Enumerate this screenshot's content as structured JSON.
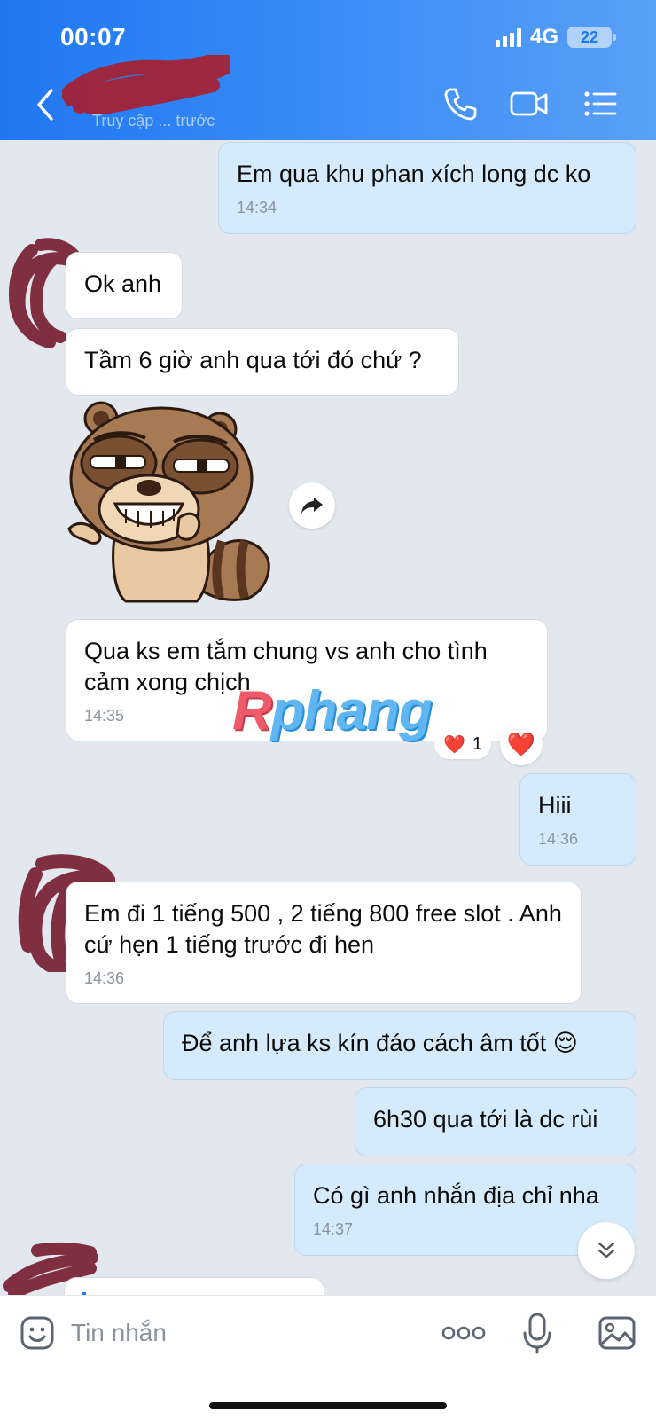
{
  "status_bar": {
    "time": "00:07",
    "network": "4G",
    "battery": "22"
  },
  "header": {
    "contact_status": "Truy cập ... trước"
  },
  "messages": [
    {
      "text": "Em qua khu phan xích long dc ko",
      "time": "14:34"
    },
    {
      "text": "Ok anh"
    },
    {
      "text": "Tầm 6 giờ anh qua tới đó chứ ?"
    },
    {
      "text": "Qua ks em tắm chung vs anh cho tình cảm xong chịch",
      "time": "14:35"
    },
    {
      "text": "Hiii",
      "time": "14:36"
    },
    {
      "text": "Em đi 1 tiếng 500 , 2 tiếng 800 free slot . Anh cứ hẹn 1 tiếng trước đi hen",
      "time": "14:36"
    },
    {
      "text": "Để anh lựa ks kín đáo cách âm tốt 😌"
    },
    {
      "text": "6h30 qua tới là dc rùi"
    },
    {
      "text": "Có gì anh nhắn địa chỉ nha",
      "time": "14:37"
    }
  ],
  "reaction": {
    "emoji": "❤️",
    "count": "1"
  },
  "react_button_emoji": "❤️",
  "watermark": {
    "first": "R",
    "rest": "phang"
  },
  "composer": {
    "placeholder": "Tin nhắn"
  },
  "icons": {
    "back": "chevron-left-icon",
    "call": "phone-icon",
    "video": "video-camera-icon",
    "menu": "list-menu-icon",
    "share": "forward-arrow-icon",
    "scroll": "double-chevron-down-icon",
    "emoji": "smiley-sticker-icon",
    "more": "more-dots-icon",
    "mic": "microphone-icon",
    "image": "image-icon"
  },
  "colors": {
    "header_start": "#1f77f2",
    "header_end": "#59a0f7",
    "bubble_out": "#d5ebfb",
    "bubble_in": "#ffffff",
    "background": "#e3e8ef"
  }
}
